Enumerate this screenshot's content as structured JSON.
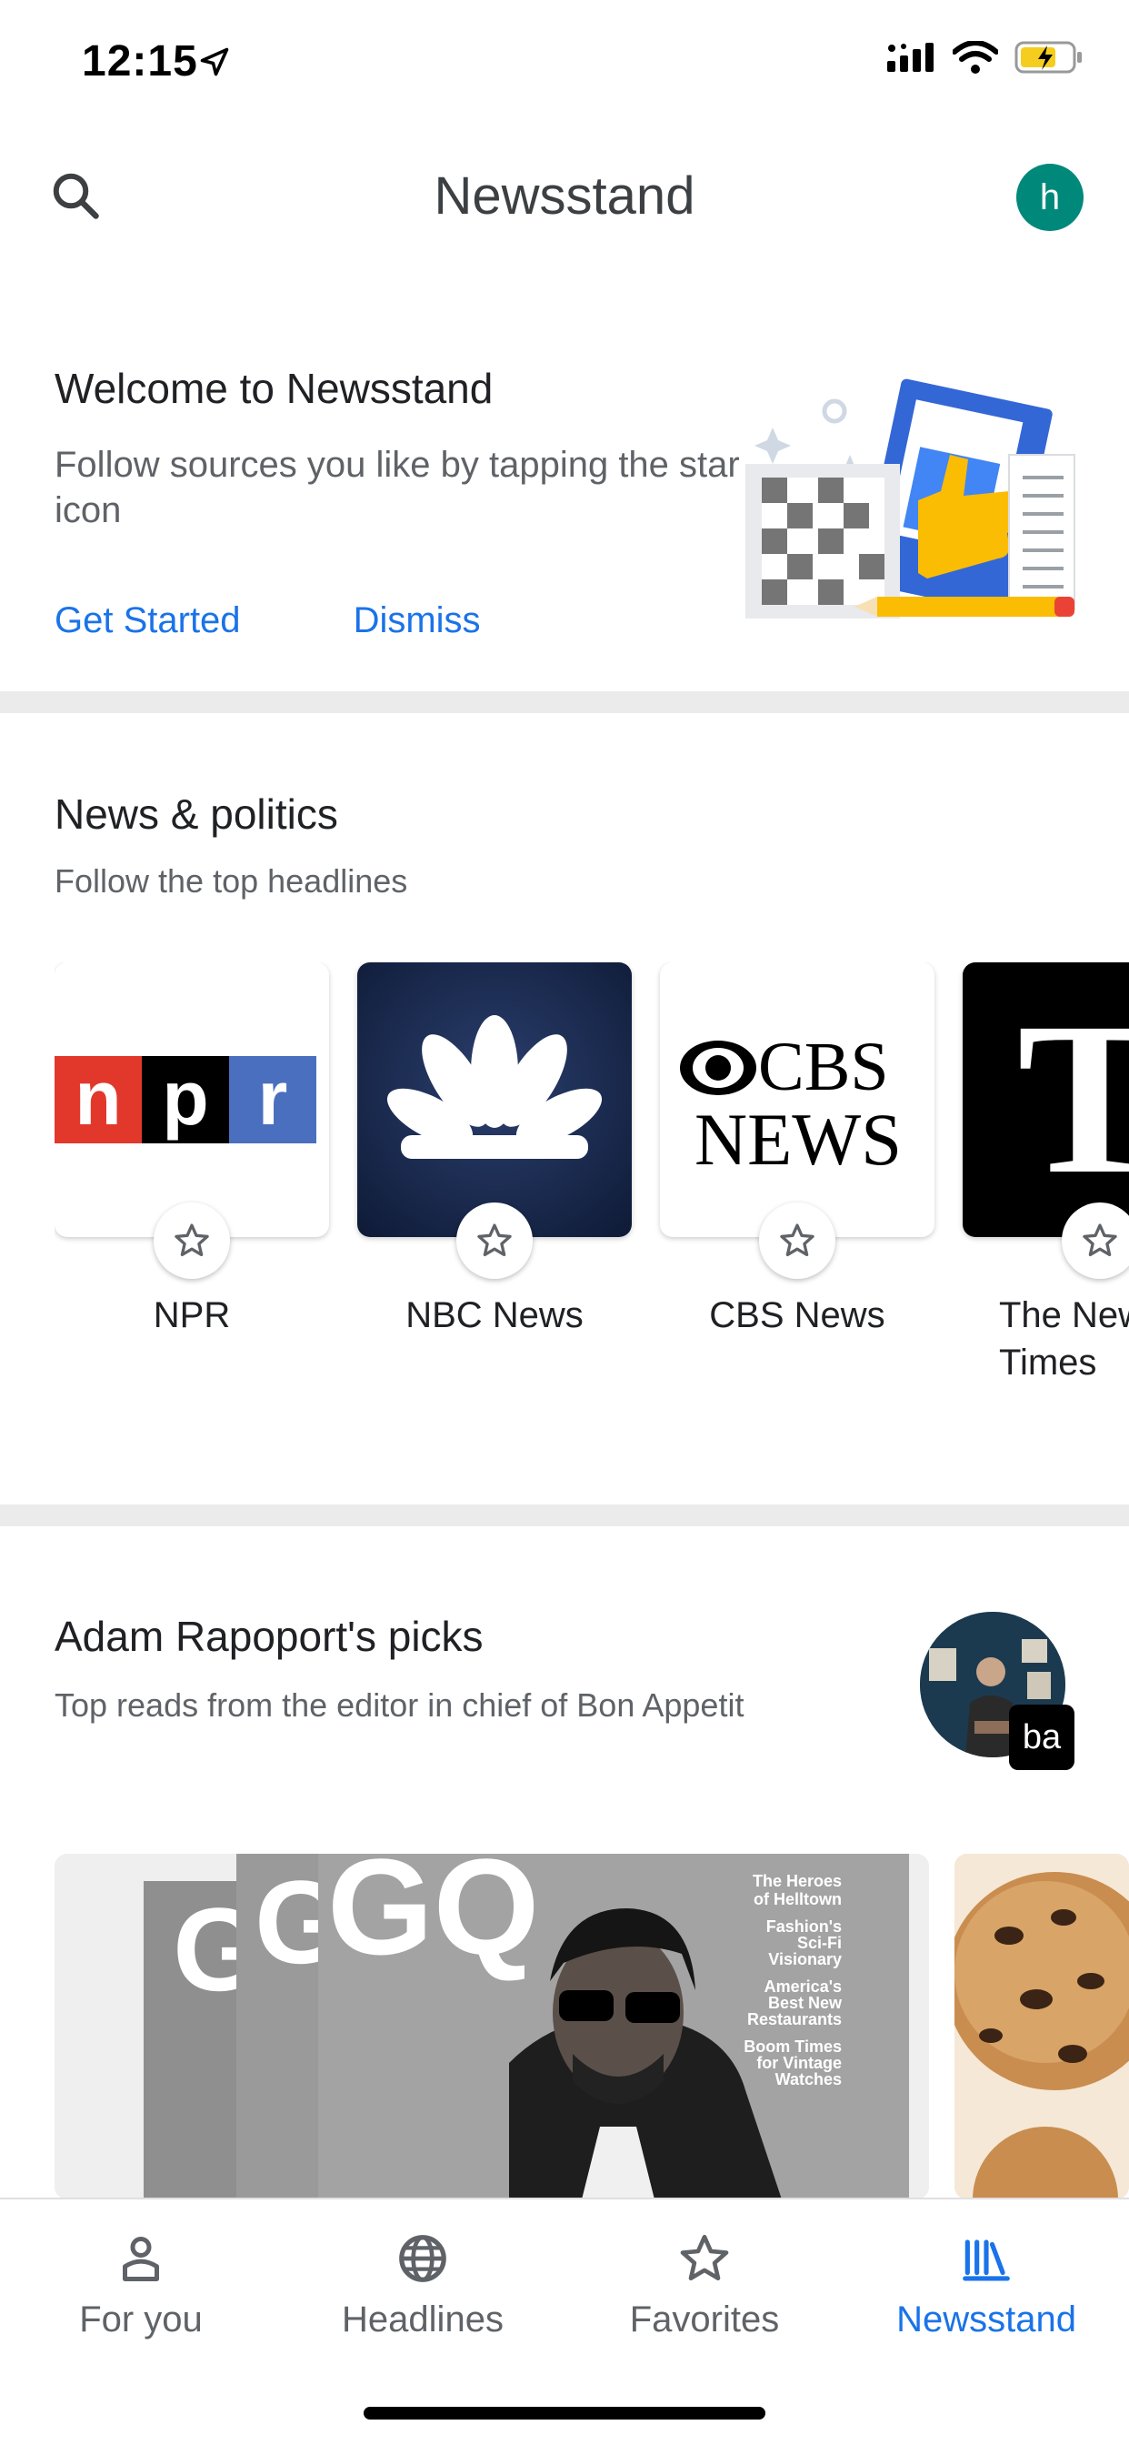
{
  "status": {
    "time": "12:15"
  },
  "app_bar": {
    "title": "Newsstand",
    "avatar_letter": "h"
  },
  "welcome": {
    "title": "Welcome to Newsstand",
    "text": "Follow sources you like by tapping the star icon",
    "get_started": "Get Started",
    "dismiss": "Dismiss"
  },
  "news_section": {
    "title": "News & politics",
    "subtitle": "Follow the top headlines",
    "sources": [
      {
        "label": "NPR",
        "logo": "npr-logo"
      },
      {
        "label": "NBC News",
        "logo": "nbc-peacock-logo"
      },
      {
        "label": "CBS News",
        "logo": "cbs-news-logo"
      },
      {
        "label": "The New York Times",
        "logo": "nyt-logo"
      }
    ]
  },
  "picks": {
    "title": "Adam Rapoport's picks",
    "subtitle": "Top reads from the editor in chief of Bon Appetit",
    "badge": "ba",
    "cover_lines": [
      "The Heroes of Helltown",
      "Fashion's Sci-Fi Visionary",
      "America's Best New Restaurants",
      "Boom Times for Vintage Watches"
    ]
  },
  "bottom_nav": {
    "items": [
      {
        "label": "For you",
        "icon": "person-icon"
      },
      {
        "label": "Headlines",
        "icon": "globe-icon"
      },
      {
        "label": "Favorites",
        "icon": "star-icon"
      },
      {
        "label": "Newsstand",
        "icon": "newsstand-icon"
      }
    ],
    "active": "Newsstand"
  },
  "colors": {
    "accent": "#1a73e8",
    "avatar": "#00897b",
    "divider": "#ebebeb"
  }
}
